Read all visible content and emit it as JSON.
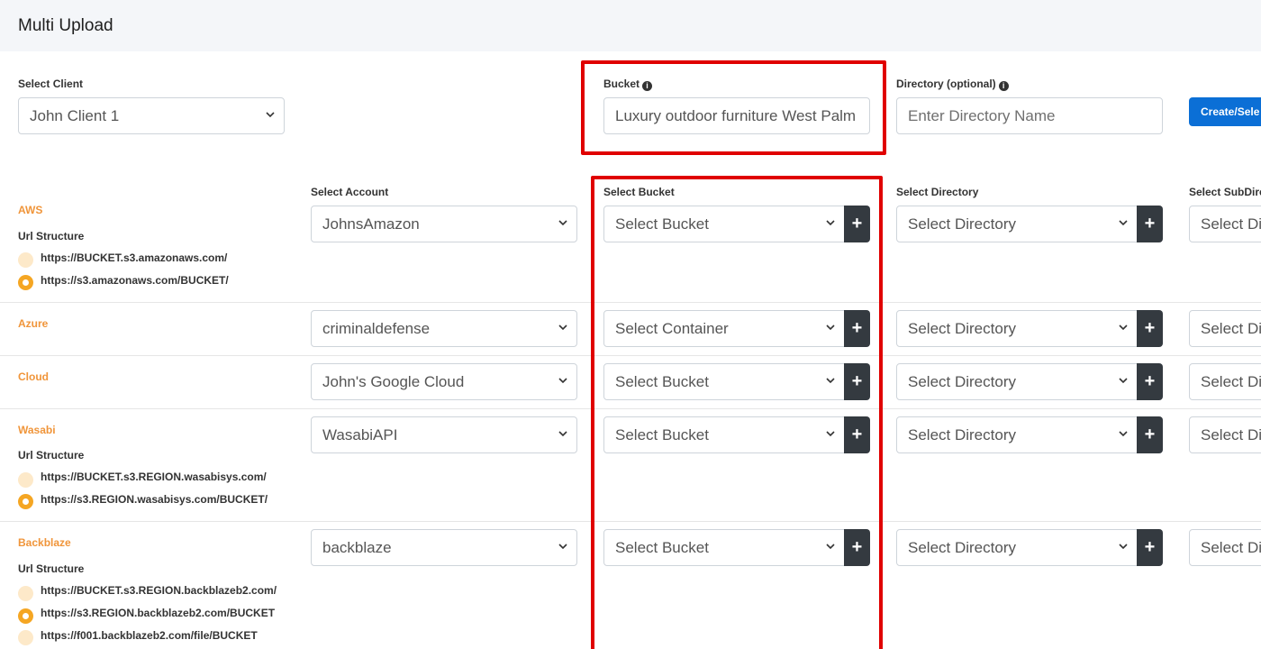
{
  "page": {
    "title": "Multi Upload"
  },
  "top": {
    "client_label": "Select Client",
    "client_value": "John Client 1",
    "bucket_label": "Bucket",
    "bucket_value": "Luxury outdoor furniture West Palm",
    "directory_label": "Directory (optional)",
    "directory_placeholder": "Enter Directory Name",
    "create_button": "Create/Sele"
  },
  "columns": {
    "account": "Select Account",
    "bucket": "Select Bucket",
    "directory": "Select Directory",
    "subdirectory": "Select SubDire"
  },
  "providers": {
    "aws": {
      "name": "AWS",
      "url_structure": "Url Structure",
      "options": [
        "https://BUCKET.s3.amazonaws.com/",
        "https://s3.amazonaws.com/BUCKET/"
      ],
      "account": "JohnsAmazon",
      "bucket": "Select Bucket",
      "directory": "Select Directory",
      "subdirectory": "Select Di"
    },
    "azure": {
      "name": "Azure",
      "account": "criminaldefense",
      "bucket": "Select Container",
      "directory": "Select Directory",
      "subdirectory": "Select Di"
    },
    "cloud": {
      "name": "Cloud",
      "account": "John's Google Cloud",
      "bucket": "Select Bucket",
      "directory": "Select Directory",
      "subdirectory": "Select Di"
    },
    "wasabi": {
      "name": "Wasabi",
      "url_structure": "Url Structure",
      "options": [
        "https://BUCKET.s3.REGION.wasabisys.com/",
        "https://s3.REGION.wasabisys.com/BUCKET/"
      ],
      "account": "WasabiAPI",
      "bucket": "Select Bucket",
      "directory": "Select Directory",
      "subdirectory": "Select Di"
    },
    "backblaze": {
      "name": "Backblaze",
      "url_structure": "Url Structure",
      "options": [
        "https://BUCKET.s3.REGION.backblazeb2.com/",
        "https://s3.REGION.backblazeb2.com/BUCKET",
        "https://f001.backblazeb2.com/file/BUCKET"
      ],
      "account": "backblaze",
      "bucket": "Select Bucket",
      "directory": "Select Directory",
      "subdirectory": "Select Di"
    }
  },
  "icons": {
    "add": "+",
    "info": "i"
  },
  "colors": {
    "accent": "#f0953a",
    "primary": "#0b6fd6",
    "highlight": "#e00000",
    "dark_button": "#343a40"
  }
}
